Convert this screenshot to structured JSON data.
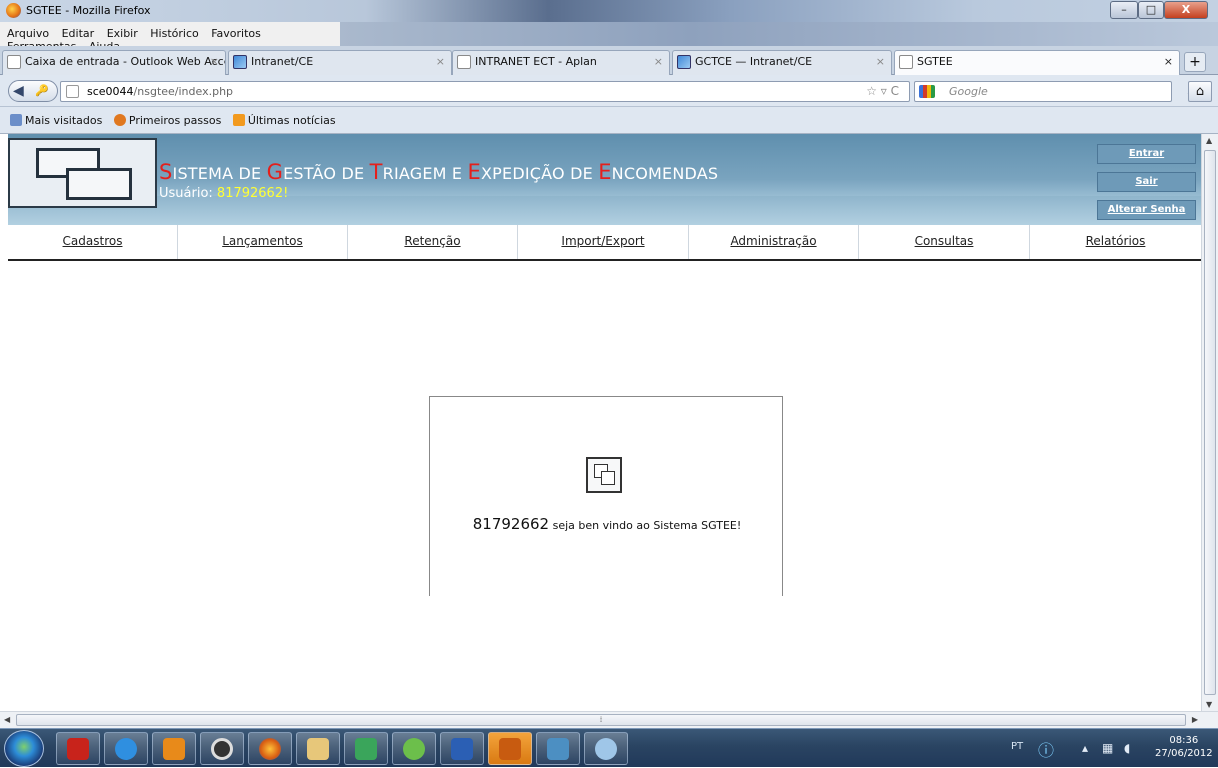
{
  "window": {
    "title": "SGTEE - Mozilla Firefox",
    "controls": {
      "minimize": "–",
      "maximize": "□",
      "close": "X"
    }
  },
  "menu": [
    "Arquivo",
    "Editar",
    "Exibir",
    "Histórico",
    "Favoritos",
    "Ferramentas",
    "Ajuda"
  ],
  "tabs": [
    {
      "label": "Caixa de entrada - Outlook Web Acce...",
      "active": false
    },
    {
      "label": "Intranet/CE",
      "active": false
    },
    {
      "label": "INTRANET ECT - Aplan",
      "active": false
    },
    {
      "label": "GCTCE — Intranet/CE",
      "active": false
    },
    {
      "label": "SGTEE",
      "active": true
    }
  ],
  "tab_close_glyph": "×",
  "new_tab_glyph": "+",
  "navbar": {
    "url_host": "sce0044",
    "url_path": "/nsgtee/index.php",
    "search_placeholder": "Google"
  },
  "bookmarks": [
    "Mais visitados",
    "Primeiros passos",
    "Últimas notícias"
  ],
  "app": {
    "title_parts": [
      {
        "cap": "S",
        "rest": "ISTEMA DE "
      },
      {
        "cap": "G",
        "rest": "ESTÃO DE "
      },
      {
        "cap": "T",
        "rest": "RIAGEM E "
      },
      {
        "cap": "E",
        "rest": "XPEDIÇÃO DE "
      },
      {
        "cap": "E",
        "rest": "NCOMENDAS"
      }
    ],
    "user_label": "Usuário: ",
    "user_id": "81792662",
    "user_suffix": "!",
    "header_buttons": [
      "Entrar",
      "Sair",
      "Alterar Senha"
    ],
    "nav": [
      "Cadastros",
      "Lançamentos",
      "Retenção",
      "Import/Export",
      "Administração",
      "Consultas",
      "Relatórios"
    ],
    "welcome": {
      "user_id": "81792662",
      "message": " seja ben vindo ao Sistema SGTEE!"
    }
  },
  "taskbar": {
    "language": "PT",
    "time": "08:36",
    "date": "27/06/2012"
  }
}
